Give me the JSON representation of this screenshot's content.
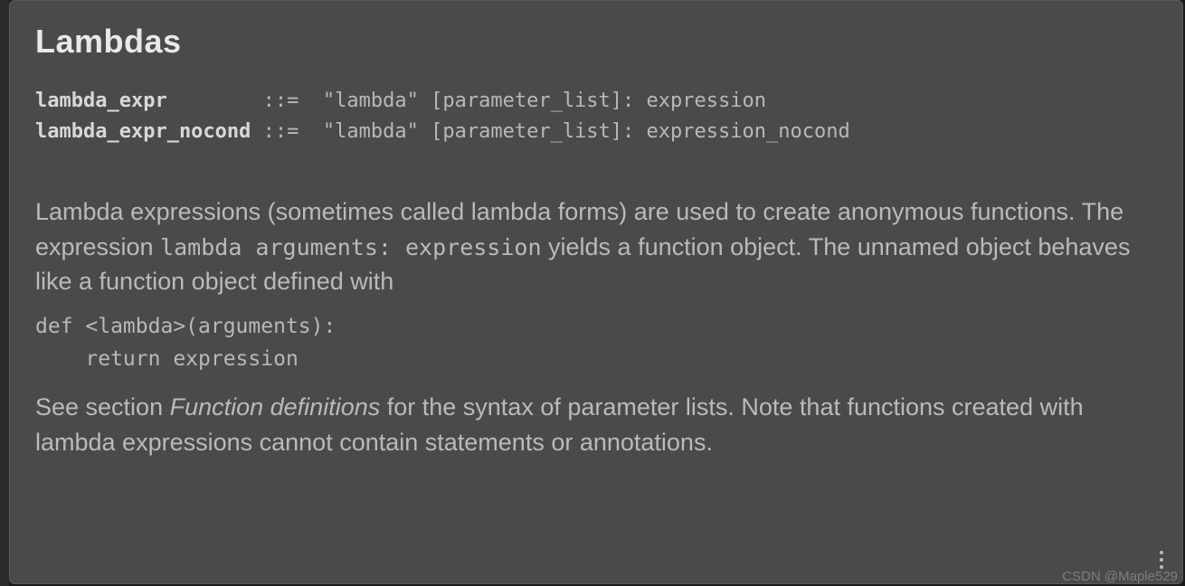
{
  "heading": "Lambdas",
  "grammar": {
    "row1_name": "lambda_expr",
    "row1_spacing": "        ",
    "sep": "::=",
    "row1_rhs": "  \"lambda\" [parameter_list]: expression",
    "row2_name": "lambda_expr_nocond",
    "row2_spacing": " ",
    "row2_rhs": "  \"lambda\" [parameter_list]: expression_nocond"
  },
  "para1_pre": "Lambda expressions (sometimes called lambda forms) are used to create anonymous functions. The expression ",
  "para1_code": "lambda arguments: expression",
  "para1_post": " yields a function object. The unnamed object behaves like a function object defined with",
  "codeblock": "def <lambda>(arguments):\n    return expression",
  "para2_pre": "See section ",
  "para2_italic": "Function definitions",
  "para2_post": " for the syntax of parameter lists. Note that functions created with lambda expressions cannot contain statements or annotations.",
  "watermark": "CSDN @Maple529"
}
